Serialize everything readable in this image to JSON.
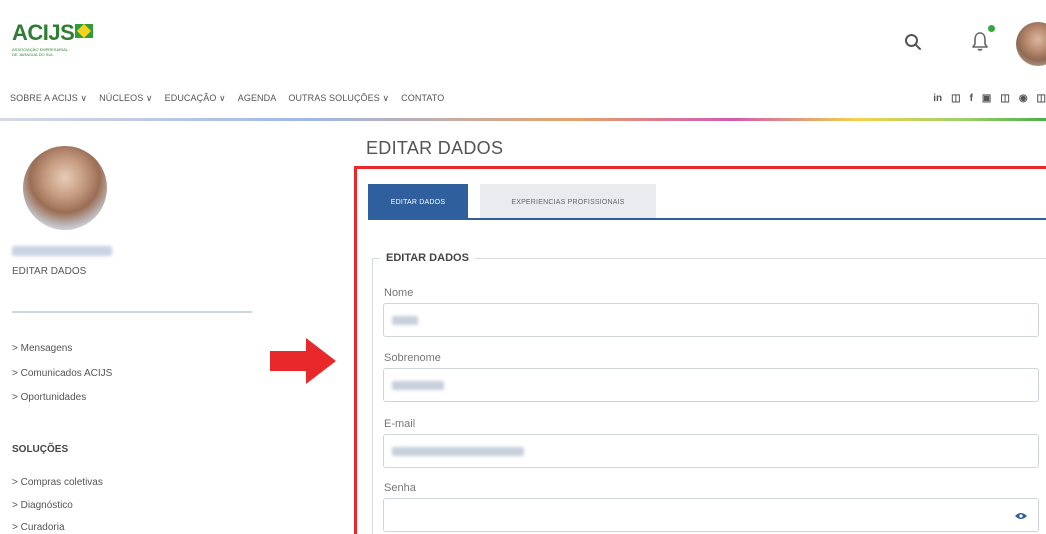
{
  "brand": {
    "name": "ACIJS",
    "subtitle": "ASSOCIAÇÃO EMPRESARIAL DE JARAGUÁ DO SUL"
  },
  "nav": {
    "items": [
      "SOBRE A ACIJS ∨",
      "NÚCLEOS ∨",
      "EDUCAÇÃO ∨",
      "AGENDA",
      "OUTRAS SOLUÇÕES ∨",
      "CONTATO"
    ]
  },
  "social": [
    "in",
    "◫",
    "f",
    "▣",
    "◫",
    "◉",
    "◫"
  ],
  "sidebar": {
    "edit_label": "EDITAR DADOS",
    "links": [
      "> Mensagens",
      "> Comunicados ACIJS",
      "> Oportunidades"
    ],
    "solutions_heading": "SOLUÇÕES",
    "solution_links": [
      "> Compras coletivas",
      "> Diagnóstico",
      "> Curadoria"
    ]
  },
  "main": {
    "title": "EDITAR DADOS",
    "tabs": [
      {
        "label": "EDITAR DADOS",
        "active": true
      },
      {
        "label": "EXPERIENCIAS PROFISSIONAIS",
        "active": false
      }
    ],
    "legend": "EDITAR DADOS",
    "fields": [
      {
        "label": "Nome"
      },
      {
        "label": "Sobrenome"
      },
      {
        "label": "E-mail"
      },
      {
        "label": "Senha"
      }
    ]
  },
  "colors": {
    "brand_green": "#2e7d32",
    "tab_active": "#2f5f9c",
    "highlight_red": "#e8282b",
    "notification_dot": "#2eaa3a"
  },
  "icons": {
    "search": "search-icon",
    "bell": "bell-icon",
    "arrow": "arrow-right-icon",
    "eye": "eye-icon"
  }
}
